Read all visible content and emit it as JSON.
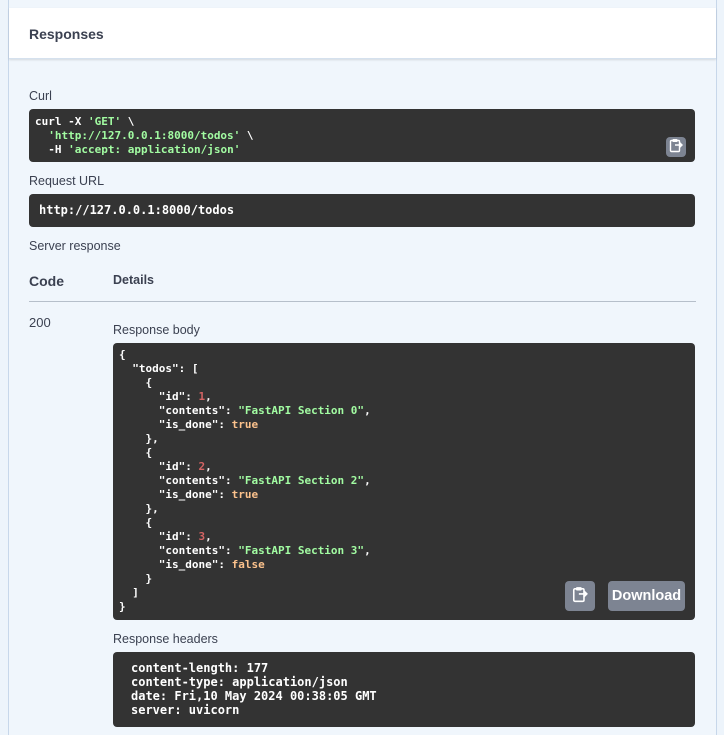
{
  "responses": {
    "title": "Responses",
    "curl_label": "Curl",
    "curl_lines": [
      {
        "prefix": "curl -X ",
        "str": "'GET'",
        "suffix": " \\"
      },
      {
        "prefix": "  ",
        "str": "'http://127.0.0.1:8000/todos'",
        "suffix": " \\"
      },
      {
        "prefix": "  -H ",
        "str": "'accept: application/json'",
        "suffix": ""
      }
    ],
    "request_url_label": "Request URL",
    "request_url": "http://127.0.0.1:8000/todos",
    "server_response_label": "Server response",
    "table": {
      "code_header": "Code",
      "details_header": "Details",
      "code": "200"
    },
    "response_body_label": "Response body",
    "response_body": {
      "todos": [
        {
          "id": 1,
          "contents": "FastAPI Section 0",
          "is_done": true
        },
        {
          "id": 2,
          "contents": "FastAPI Section 2",
          "is_done": true
        },
        {
          "id": 3,
          "contents": "FastAPI Section 3",
          "is_done": false
        }
      ]
    },
    "download_label": "Download",
    "response_headers_label": "Response headers",
    "response_headers": [
      "content-length: 177",
      "content-type: application/json",
      "date: Fri,10 May 2024 00:38:05 GMT",
      "server: uvicorn"
    ]
  },
  "icons": {
    "copy": "clipboard-icon"
  },
  "colors": {
    "code_bg": "#333333",
    "string": "#a2fca2",
    "number": "#d36363",
    "literal": "#fcc28c",
    "button": "#7d8492"
  }
}
